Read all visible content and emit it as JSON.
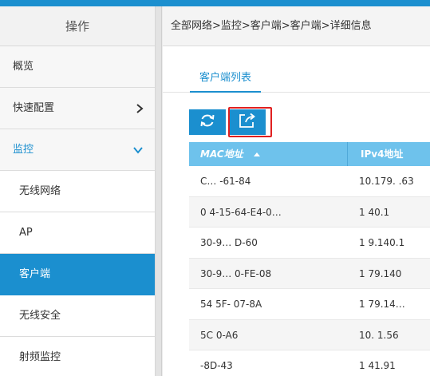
{
  "sidebar": {
    "title": "操作",
    "items": [
      {
        "label": "概览",
        "chevron": ""
      },
      {
        "label": "快速配置",
        "chevron": "›"
      },
      {
        "label": "监控",
        "chevron": "⌄"
      },
      {
        "label": "无线网络"
      },
      {
        "label": "AP"
      },
      {
        "label": "客户端"
      },
      {
        "label": "无线安全"
      },
      {
        "label": "射频监控"
      }
    ]
  },
  "breadcrumb": "全部网络>监控>客户端>客户端>详细信息",
  "tabs": [
    {
      "label": "客户端列表"
    }
  ],
  "toolbar": {
    "refresh_icon": "refresh-icon",
    "export_icon": "export-icon"
  },
  "table": {
    "columns": [
      "MAC地址",
      "IPv4地址"
    ],
    "rows": [
      {
        "mac": "C…            -61-84",
        "ip": "10.179.       .63"
      },
      {
        "mac": "0      4-15-64-E4-0…",
        "ip": "1         40.1"
      },
      {
        "mac": "30-9…            D-60",
        "ip": "1       9.140.1"
      },
      {
        "mac": "30-9…         0-FE-08",
        "ip": "1       79.140"
      },
      {
        "mac": "54       5F-      07-8A",
        "ip": "1       79.14…"
      },
      {
        "mac": "5C                 0-A6",
        "ip": "10.           1.56"
      },
      {
        "mac": "                 -8D-43",
        "ip": "1            41.91"
      }
    ]
  },
  "colors": {
    "accent": "#1b8fcf",
    "table_header": "#6ec2ec",
    "highlight": "#e02020"
  }
}
